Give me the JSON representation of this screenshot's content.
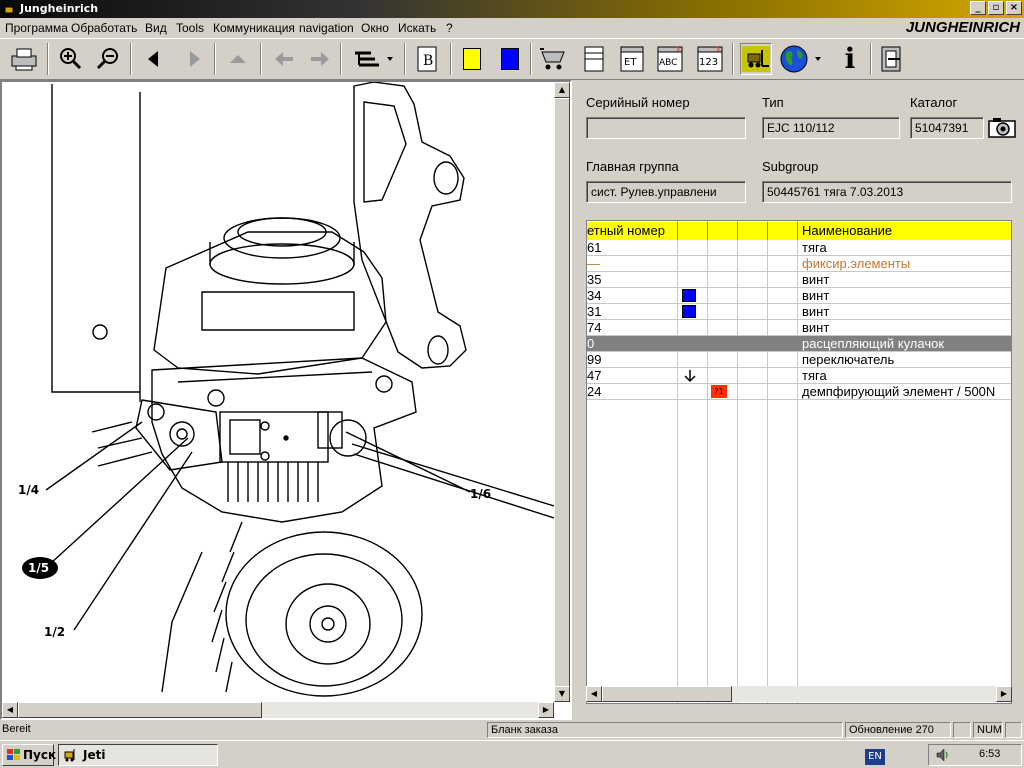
{
  "window": {
    "title": "Jungheinrich"
  },
  "brand": {
    "logo_text": "JUNGHEINRICH"
  },
  "menu": [
    "Программа",
    "Обработать",
    "Вид",
    "Tools",
    "Коммуникация",
    "navigation",
    "Окно",
    "Искать",
    "?"
  ],
  "toolbar": {
    "color_yellow": "#ffff00",
    "color_blue": "#0000ff",
    "label_b": "B",
    "label_et": "ET",
    "label_abc": "ABC",
    "label_123": "123",
    "label_info": "i"
  },
  "drawing": {
    "callouts": [
      "1/4",
      "1/5",
      "1/2",
      "1/6"
    ]
  },
  "info": {
    "serial_label": "Серийный номер",
    "serial_value": "",
    "type_label": "Тип",
    "type_value": "EJC 110/112",
    "catalog_label": "Каталог",
    "catalog_value": "51047391",
    "main_group_label": "Главная группа",
    "main_group_value": "сист. Рулев.управлени",
    "subgroup_label": "Subgroup",
    "subgroup_value": "50445761  тяга 7.03.2013"
  },
  "parts_table": {
    "header": {
      "number": "етный номер",
      "name": "Наименование"
    },
    "rows": [
      {
        "number": "61",
        "name": "тяга",
        "marker": ""
      },
      {
        "number": "—",
        "name": "фиксир.элементы",
        "marker": "",
        "style": "group"
      },
      {
        "number": "35",
        "name": "винт",
        "marker": ""
      },
      {
        "number": "34",
        "name": "винт",
        "marker": "blue"
      },
      {
        "number": "31",
        "name": "винт",
        "marker": "blue"
      },
      {
        "number": "74",
        "name": "винт",
        "marker": ""
      },
      {
        "number": "0",
        "name": "расцепляющий кулачок",
        "marker": "",
        "style": "selected"
      },
      {
        "number": "99",
        "name": "переключатель",
        "marker": ""
      },
      {
        "number": "47",
        "name": "тяга",
        "marker": "arrow"
      },
      {
        "number": "24",
        "name": "демпфирующий элемент / 500N",
        "marker": "red"
      }
    ],
    "red_marker_text": "?1"
  },
  "status": {
    "ready": "Bereit",
    "order_form": "Бланк заказа",
    "update": "Обновление 270",
    "num": "NUM"
  },
  "taskbar": {
    "start": "Пуск",
    "task": "Jeti",
    "lang": "EN",
    "time": "6:53"
  },
  "colors": {
    "accent": "#d4a800",
    "selection": "#808080",
    "header": "#ffff00",
    "group_text": "#c07830",
    "marker_blue": "#0000ff",
    "marker_red": "#ff3300"
  }
}
